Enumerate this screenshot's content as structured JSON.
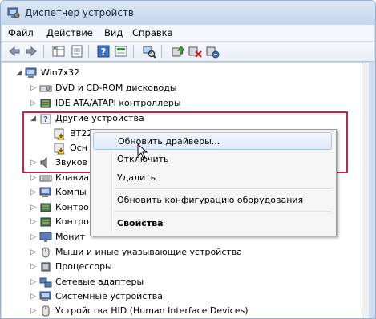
{
  "window": {
    "title": "Диспетчер устройств"
  },
  "menu": [
    "Файл",
    "Действие",
    "Вид",
    "Справка"
  ],
  "toolbar": {
    "icons": [
      "back-icon",
      "forward-icon",
      "properties-grid-icon",
      "document-icon",
      "help-icon",
      "refresh-view-icon",
      "scan-hardware-icon",
      "update-driver-icon",
      "disable-device-icon",
      "uninstall-icon"
    ]
  },
  "tree": {
    "root": "Win7x32",
    "items": [
      {
        "label": "DVD и CD-ROM дисководы",
        "icon": "dvd-drive-icon"
      },
      {
        "label": "IDE ATA/ATAPI контроллеры",
        "icon": "ide-controller-icon"
      },
      {
        "label": "Другие устройства",
        "icon": "unknown-device-icon",
        "expanded": true,
        "children": [
          {
            "label": "BT229912_COM",
            "icon": "warning-device-icon"
          },
          {
            "label": "Осн",
            "icon": "warning-device-icon"
          }
        ]
      },
      {
        "label": "Звуков",
        "icon": "sound-icon"
      },
      {
        "label": "Клавиа",
        "icon": "keyboard-icon"
      },
      {
        "label": "Компы",
        "icon": "computer-icon"
      },
      {
        "label": "Контро",
        "icon": "controller-icon"
      },
      {
        "label": "Контро",
        "icon": "controller-icon"
      },
      {
        "label": "Монит",
        "icon": "monitor-icon"
      },
      {
        "label": "Мыши и иные указывающие устройства",
        "icon": "mouse-icon"
      },
      {
        "label": "Процессоры",
        "icon": "processor-icon"
      },
      {
        "label": "Сетевые адаптеры",
        "icon": "network-adapter-icon"
      },
      {
        "label": "Системные устройства",
        "icon": "system-device-icon"
      },
      {
        "label": "Устройства HID (Human Interface Devices)",
        "icon": "hid-icon"
      }
    ]
  },
  "context_menu": {
    "items": [
      {
        "label": "Обновить драйверы...",
        "highlighted": true
      },
      {
        "label": "Отключить"
      },
      {
        "label": "Удалить"
      },
      {
        "label": "Обновить конфигурацию оборудования"
      },
      {
        "label": "Свойства",
        "bold": true
      }
    ]
  },
  "colors": {
    "highlight_box": "#c8234a",
    "title_bar": "#c3d5ec",
    "menu_highlight": "#dfeafa"
  }
}
